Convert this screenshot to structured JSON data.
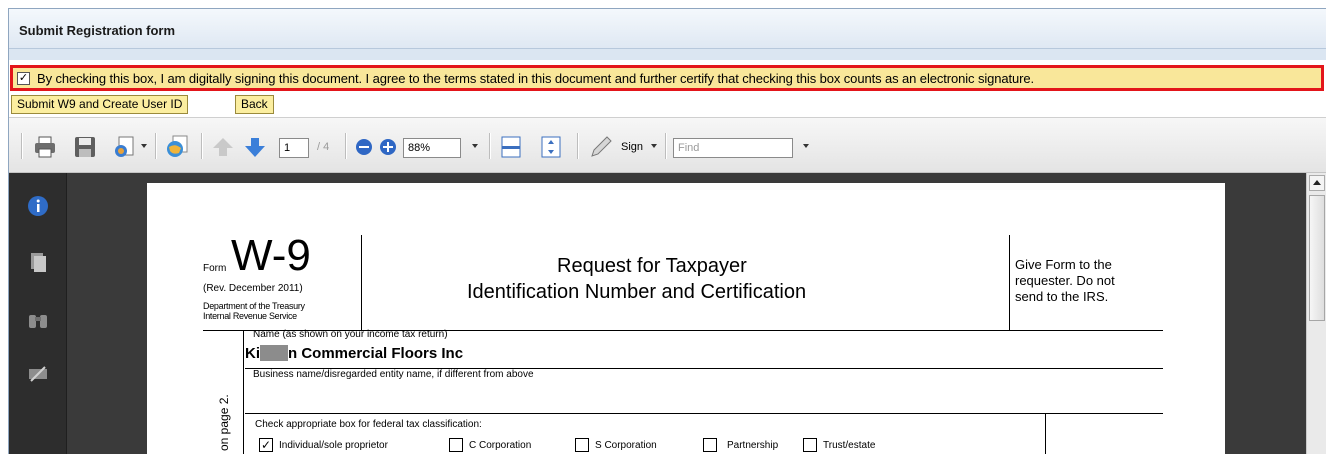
{
  "window": {
    "title": "Submit Registration form"
  },
  "consent": {
    "checked_mark": "✓",
    "text": "By checking this box, I am digitally signing this document. I agree to the terms stated in this document and further certify that checking this box counts as an electronic signature."
  },
  "buttons": {
    "submit": "Submit W9 and Create User ID",
    "back": "Back"
  },
  "toolbar": {
    "page_current": "1",
    "page_total": "/ 4",
    "zoom": "88%",
    "sign": "Sign",
    "find_placeholder": "Find"
  },
  "form": {
    "form_label": "Form",
    "form_number": "W-9",
    "revision": "(Rev. December 2011)",
    "department": "Department of the Treasury",
    "service": "Internal Revenue Service",
    "title_line1": "Request for Taxpayer",
    "title_line2": "Identification Number and Certification",
    "instruction": "Give Form to the requester. Do not send to the IRS.",
    "name_label": "Name (as shown on your income tax return)",
    "name_value_prefix": "Ki",
    "name_value_suffix": "n Commercial Floors Inc",
    "business_label": "Business name/disregarded entity name, if different from above",
    "side_text": "on page 2.",
    "classification_label": "Check appropriate box for federal tax classification:",
    "options": [
      {
        "label": "Individual/sole proprietor",
        "checked": true
      },
      {
        "label": "C Corporation",
        "checked": false
      },
      {
        "label": "S Corporation",
        "checked": false
      },
      {
        "label": "Partnership",
        "checked": false
      },
      {
        "label": "Trust/estate",
        "checked": false
      }
    ]
  },
  "colors": {
    "highlight_border": "#e3151a",
    "highlight_bg": "#f9e79a",
    "button_bg": "#fbeea0"
  }
}
